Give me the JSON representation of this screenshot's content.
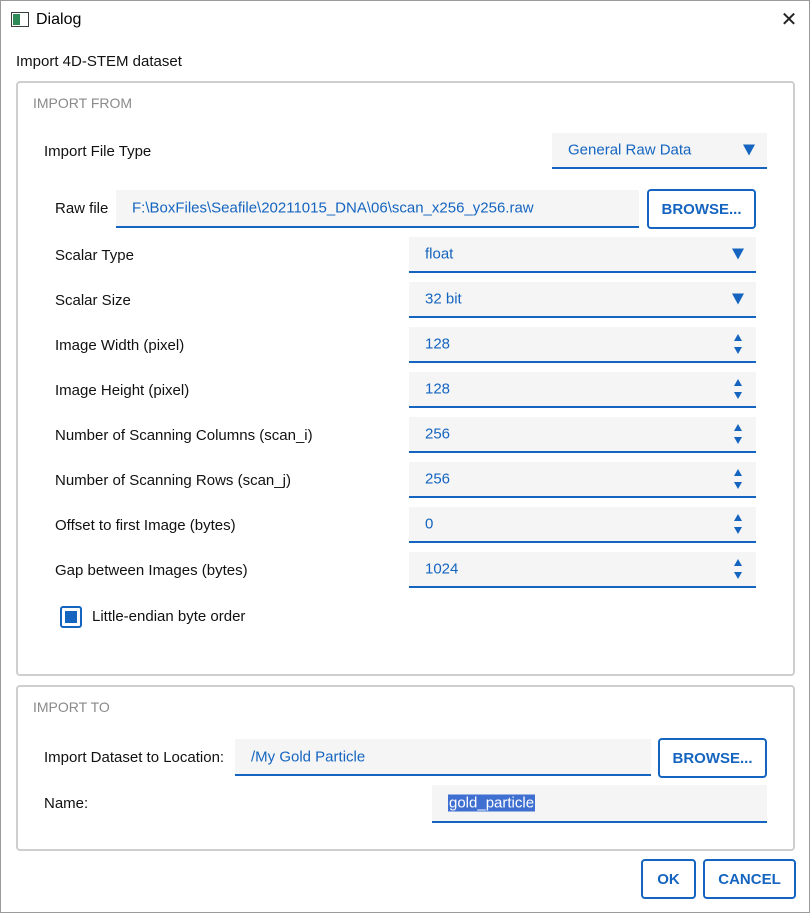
{
  "window": {
    "title": "Dialog"
  },
  "heading": "Import 4D-STEM dataset",
  "import_from": {
    "title": "IMPORT FROM",
    "file_type": {
      "label": "Import File Type",
      "value": "General Raw Data"
    },
    "raw_file": {
      "label": "Raw file",
      "value": "F:\\BoxFiles\\Seafile\\20211015_DNA\\06\\scan_x256_y256.raw",
      "browse_label": "BROWSE..."
    },
    "scalar_type": {
      "label": "Scalar Type",
      "value": "float"
    },
    "scalar_size": {
      "label": "Scalar Size",
      "value": "32 bit"
    },
    "image_width": {
      "label": "Image Width (pixel)",
      "value": "128"
    },
    "image_height": {
      "label": "Image Height (pixel)",
      "value": "128"
    },
    "scan_columns": {
      "label": "Number of Scanning Columns (scan_i)",
      "value": "256"
    },
    "scan_rows": {
      "label": "Number of Scanning Rows (scan_j)",
      "value": "256"
    },
    "offset": {
      "label": "Offset to first Image (bytes)",
      "value": "0"
    },
    "gap": {
      "label": "Gap between Images (bytes)",
      "value": "1024"
    },
    "little_endian": {
      "label": "Little-endian byte order",
      "checked": true
    }
  },
  "import_to": {
    "title": "IMPORT TO",
    "location": {
      "label": "Import Dataset to Location:",
      "value": "/My Gold Particle",
      "browse_label": "BROWSE..."
    },
    "name": {
      "label": "Name:",
      "value": "gold_particle"
    }
  },
  "buttons": {
    "ok": "OK",
    "cancel": "CANCEL"
  },
  "colors": {
    "accent": "#1565c0",
    "field_bg": "#f5f5f5",
    "group_border": "#cfcfcf",
    "group_title": "#8a8a8a",
    "selection": "#3f6fd1"
  }
}
